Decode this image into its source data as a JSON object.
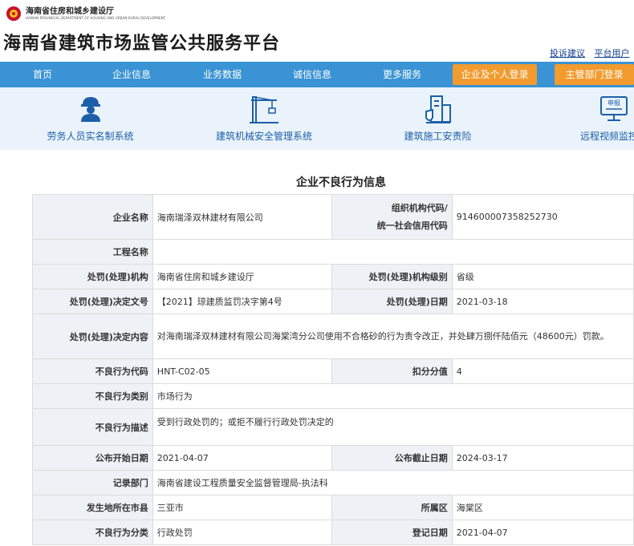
{
  "header": {
    "dept_name_cn": "海南省住房和城乡建设厅",
    "dept_name_en": "HAINAN PROVINCIAL DEPARTMENT OF HOUSING AND URBAN-RURAL DEVELOPMENT",
    "site_title": "海南省建筑市场监管公共服务平台",
    "links": [
      "投诉建议",
      "平台用户"
    ]
  },
  "nav": {
    "items": [
      "首页",
      "企业信息",
      "业务数据",
      "诚信信息",
      "更多服务"
    ],
    "buttons": [
      "企业及个人登录",
      "主管部门登录"
    ]
  },
  "systems": [
    {
      "label": "劳务人员实名制系统",
      "icon": "worker-icon"
    },
    {
      "label": "建筑机械安全管理系统",
      "icon": "crane-icon"
    },
    {
      "label": "建筑施工安责险",
      "icon": "insurance-icon"
    },
    {
      "label": "远程视频监控申",
      "icon": "monitor-icon"
    }
  ],
  "section_title": "企业不良行为信息",
  "record": {
    "company_name_label": "企业名称",
    "company_name": "海南瑞泽双林建材有限公司",
    "org_code_label_1": "组织机构代码/",
    "org_code_label_2": "统一社会信用代码",
    "org_code": "914600007358252730",
    "project_label": "工程名称",
    "project": "",
    "agency_label": "处罚(处理)机构",
    "agency": "海南省住房和城乡建设厅",
    "agency_level_label": "处罚(处理)机构级别",
    "agency_level": "省级",
    "doc_no_label": "处罚(处理)决定文号",
    "doc_no": "【2021】琼建质监罚决字第4号",
    "date_label": "处罚(处理)日期",
    "date": "2021-03-18",
    "content_label": "处罚(处理)决定内容",
    "content": "对海南瑞泽双林建材有限公司海棠湾分公司使用不合格砂的行为责令改正，并处肆万捌仟陆佰元（48600元）罚款。",
    "code_label": "不良行为代码",
    "code": "HNT-C02-05",
    "score_label": "扣分分值",
    "score": "4",
    "category_label": "不良行为类别",
    "category": "市场行为",
    "desc_label": "不良行为描述",
    "desc": "受到行政处罚的；或拒不履行行政处罚决定的",
    "pub_start_label": "公布开始日期",
    "pub_start": "2021-04-07",
    "pub_end_label": "公布截止日期",
    "pub_end": "2024-03-17",
    "dept_label": "记录部门",
    "dept": "海南省建设工程质量安全监督管理局-执法科",
    "city_label": "发生地所在市县",
    "city": "三亚市",
    "district_label": "所属区",
    "district": "海棠区",
    "class_label": "不良行为分类",
    "class": "行政处罚",
    "reg_date_label": "登记日期",
    "reg_date": "2021-04-07"
  },
  "colors": {
    "nav_bg": "#3a93d4",
    "nav_button": "#f29b2e",
    "system_strip": "#eaf3fb",
    "system_link": "#1c5fa8",
    "label_cell": "#eef1f5"
  }
}
